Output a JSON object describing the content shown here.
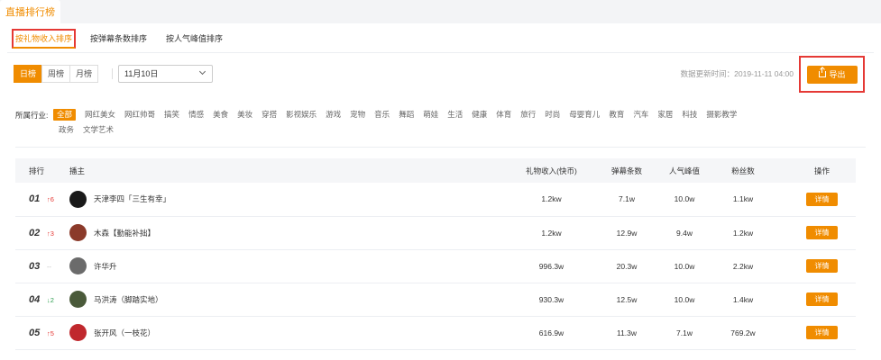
{
  "top_tab": "直播排行榜",
  "sub_tabs": [
    "按礼物收入排序",
    "按弹幕条数排序",
    "按人气峰值排序"
  ],
  "period": [
    "日榜",
    "周榜",
    "月榜"
  ],
  "date_value": "11月10日",
  "updated_text": "数据更新时间：2019-11-11 04:00",
  "export_label": "导出",
  "industry_label": "所属行业:",
  "industries_row1": [
    "全部",
    "网红美女",
    "网红帅哥",
    "搞笑",
    "情感",
    "美食",
    "美妆",
    "穿搭",
    "影视娱乐",
    "游戏",
    "宠物",
    "音乐",
    "舞蹈",
    "萌娃",
    "生活",
    "健康",
    "体育",
    "旅行",
    "时尚",
    "母婴育儿",
    "教育",
    "汽车",
    "家居",
    "科技",
    "摄影教学"
  ],
  "industries_row2": [
    "政务",
    "文学艺术"
  ],
  "table": {
    "headers": [
      "排行",
      "播主",
      "礼物收入(快币)",
      "弹幕条数",
      "人气峰值",
      "粉丝数",
      "操作"
    ],
    "rows": [
      {
        "rank": "01",
        "change": "↑6",
        "dir": "up",
        "name": "天津李四「三生有幸」",
        "gift": "1.2kw",
        "danmu": "7.1w",
        "peak": "10.0w",
        "fans": "1.1kw",
        "action": "详情",
        "avatar": "#1a1a1a"
      },
      {
        "rank": "02",
        "change": "↑3",
        "dir": "up",
        "name": "木森【勤能补拙】",
        "gift": "1.2kw",
        "danmu": "12.9w",
        "peak": "9.4w",
        "fans": "1.2kw",
        "action": "详情",
        "avatar": "#8b3a2a"
      },
      {
        "rank": "03",
        "change": "--",
        "dir": "flat",
        "name": "许华升",
        "gift": "996.3w",
        "danmu": "20.3w",
        "peak": "10.0w",
        "fans": "2.2kw",
        "action": "详情",
        "avatar": "#6b6b6b"
      },
      {
        "rank": "04",
        "change": "↓2",
        "dir": "down",
        "name": "马洪涛（脚踏实地）",
        "gift": "930.3w",
        "danmu": "12.5w",
        "peak": "10.0w",
        "fans": "1.4kw",
        "action": "详情",
        "avatar": "#4a5a3a"
      },
      {
        "rank": "05",
        "change": "↑5",
        "dir": "up",
        "name": "张开风（一枝花）",
        "gift": "616.9w",
        "danmu": "11.3w",
        "peak": "7.1w",
        "fans": "769.2w",
        "action": "详情",
        "avatar": "#c0282d"
      }
    ]
  }
}
